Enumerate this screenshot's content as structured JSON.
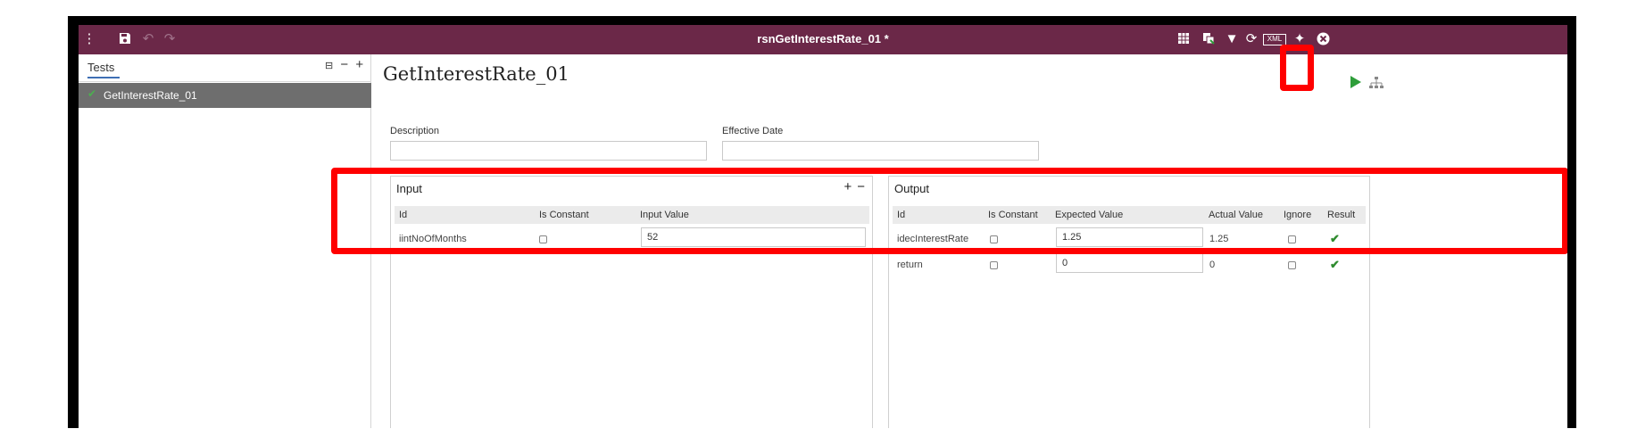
{
  "titlebar": {
    "title": "rsnGetInterestRate_01 *",
    "icons_left": [
      "menu-dots-icon",
      "save-icon",
      "undo-icon",
      "redo-icon"
    ],
    "icons_right": [
      "grid-icon",
      "copy-icon",
      "dropdown-icon",
      "refresh-icon",
      "xml-icon",
      "pin-icon",
      "close-icon"
    ],
    "xml_label": "XML",
    "background": "#6b2848"
  },
  "left_panel": {
    "tab_label": "Tests",
    "actions": [
      "tree-toggle-icon",
      "remove-icon",
      "add-icon"
    ],
    "items": [
      {
        "label": "GetInterestRate_01",
        "status": "passed"
      }
    ]
  },
  "main": {
    "title": "GetInterestRate_01",
    "description_label": "Description",
    "description_value": "",
    "effective_date_label": "Effective Date",
    "effective_date_value": ""
  },
  "input_panel": {
    "title": "Input",
    "columns": [
      "Id",
      "Is Constant",
      "Input Value"
    ],
    "rows": [
      {
        "id": "iintNoOfMonths",
        "is_constant": false,
        "value": "52"
      }
    ]
  },
  "output_panel": {
    "title": "Output",
    "columns": [
      "Id",
      "Is Constant",
      "Expected Value",
      "Actual Value",
      "Ignore",
      "Result"
    ],
    "rows": [
      {
        "id": "idecInterestRate",
        "is_constant": false,
        "expected": "1.25",
        "actual": "1.25",
        "ignore": false,
        "result": "pass"
      },
      {
        "id": "return",
        "is_constant": false,
        "expected": "0",
        "actual": "0",
        "ignore": false,
        "result": "pass"
      }
    ]
  },
  "colors": {
    "accent": "#6b2848",
    "highlight": "#ff0000",
    "success": "#2e8b2e"
  }
}
